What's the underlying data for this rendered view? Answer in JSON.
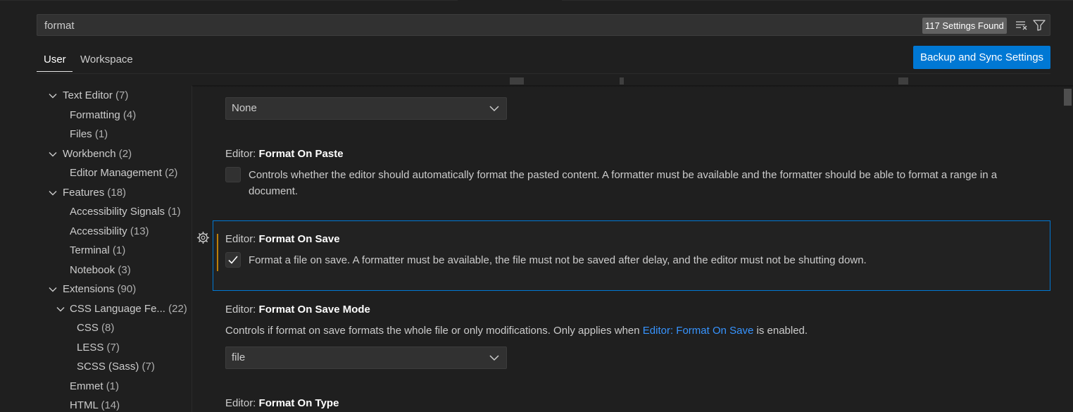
{
  "search": {
    "value": "format",
    "result_count": "117 Settings Found",
    "clear_icon": "clear-filter-icon",
    "filter_icon": "filter-icon"
  },
  "tabs": [
    {
      "label": "User",
      "active": true
    },
    {
      "label": "Workspace",
      "active": false
    }
  ],
  "sync_button": "Backup and Sync Settings",
  "toc": [
    {
      "label": "Text Editor",
      "count": "(7)",
      "level": 0,
      "expandable": true
    },
    {
      "label": "Formatting",
      "count": "(4)",
      "level": 1,
      "expandable": false
    },
    {
      "label": "Files",
      "count": "(1)",
      "level": 1,
      "expandable": false
    },
    {
      "label": "Workbench",
      "count": "(2)",
      "level": 0,
      "expandable": true
    },
    {
      "label": "Editor Management",
      "count": "(2)",
      "level": 1,
      "expandable": false
    },
    {
      "label": "Features",
      "count": "(18)",
      "level": 0,
      "expandable": true
    },
    {
      "label": "Accessibility Signals",
      "count": "(1)",
      "level": 1,
      "expandable": false
    },
    {
      "label": "Accessibility",
      "count": "(13)",
      "level": 1,
      "expandable": false
    },
    {
      "label": "Terminal",
      "count": "(1)",
      "level": 1,
      "expandable": false
    },
    {
      "label": "Notebook",
      "count": "(3)",
      "level": 1,
      "expandable": false
    },
    {
      "label": "Extensions",
      "count": "(90)",
      "level": 0,
      "expandable": true
    },
    {
      "label": "CSS Language Fe...",
      "count": "(22)",
      "level": 1,
      "expandable": true
    },
    {
      "label": "CSS",
      "count": "(8)",
      "level": 2,
      "expandable": false
    },
    {
      "label": "LESS",
      "count": "(7)",
      "level": 2,
      "expandable": false
    },
    {
      "label": "SCSS (Sass)",
      "count": "(7)",
      "level": 2,
      "expandable": false
    },
    {
      "label": "Emmet",
      "count": "(1)",
      "level": 1,
      "expandable": false
    },
    {
      "label": "HTML",
      "count": "(14)",
      "level": 1,
      "expandable": false
    }
  ],
  "settings": {
    "top_select": {
      "value": "None"
    },
    "format_on_paste": {
      "category": "Editor: ",
      "name": "Format On Paste",
      "description": "Controls whether the editor should automatically format the pasted content. A formatter must be available and the formatter should be able to format a range in a document.",
      "checked": false
    },
    "format_on_save": {
      "category": "Editor: ",
      "name": "Format On Save",
      "description": "Format a file on save. A formatter must be available, the file must not be saved after delay, and the editor must not be shutting down.",
      "checked": true,
      "gear_icon": "gear-icon"
    },
    "format_on_save_mode": {
      "category": "Editor: ",
      "name": "Format On Save Mode",
      "description_before": "Controls if format on save formats the whole file or only modifications. Only applies when ",
      "description_link": "Editor: Format On Save",
      "description_after": " is enabled.",
      "value": "file"
    },
    "format_on_type": {
      "category": "Editor: ",
      "name": "Format On Type"
    }
  },
  "colors": {
    "accent": "#0078d4",
    "link": "#3794ff",
    "modified": "#bb800a",
    "background": "#1f1f1f"
  }
}
